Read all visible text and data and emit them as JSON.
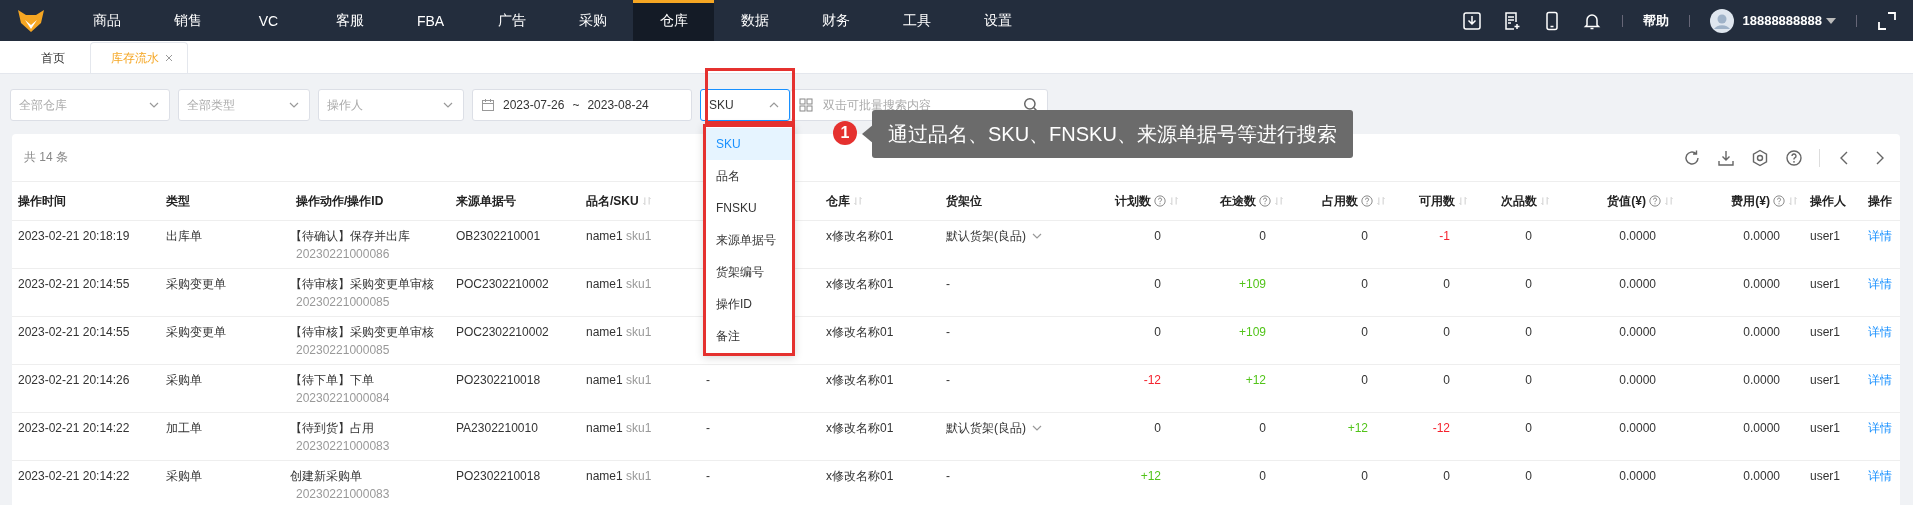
{
  "nav": {
    "items": [
      {
        "label": "商品",
        "selected": false
      },
      {
        "label": "销售",
        "selected": false
      },
      {
        "label": "VC",
        "selected": false
      },
      {
        "label": "客服",
        "selected": false
      },
      {
        "label": "FBA",
        "selected": false
      },
      {
        "label": "广告",
        "selected": false
      },
      {
        "label": "采购",
        "selected": false
      },
      {
        "label": "仓库",
        "selected": true
      },
      {
        "label": "数据",
        "selected": false
      },
      {
        "label": "财务",
        "selected": false
      },
      {
        "label": "工具",
        "selected": false
      },
      {
        "label": "设置",
        "selected": false
      }
    ],
    "help": "帮助",
    "user": "18888888888"
  },
  "tabs": [
    {
      "label": "首页",
      "selected": false,
      "closable": false
    },
    {
      "label": "库存流水",
      "selected": true,
      "closable": true
    }
  ],
  "filters": {
    "warehouse": "全部仓库",
    "type": "全部类型",
    "operator": "操作人",
    "date_start": "2023-07-26",
    "date_sep": "~",
    "date_end": "2023-08-24",
    "search_field": "SKU",
    "search_placeholder": "双击可批量搜索内容"
  },
  "search_field_menu": [
    {
      "label": "SKU",
      "selected": true
    },
    {
      "label": "品名",
      "selected": false
    },
    {
      "label": "FNSKU",
      "selected": false
    },
    {
      "label": "来源单据号",
      "selected": false
    },
    {
      "label": "货架编号",
      "selected": false
    },
    {
      "label": "操作ID",
      "selected": false
    },
    {
      "label": "备注",
      "selected": false
    }
  ],
  "callout": {
    "number": "1",
    "text": "通过品名、SKU、FNSKU、来源单据号等进行搜索"
  },
  "table": {
    "total": "共 14 条",
    "columns": [
      {
        "label": "操作时间",
        "help": false,
        "sortable": false
      },
      {
        "label": "类型",
        "help": false,
        "sortable": false
      },
      {
        "label": "操作动作/操作ID",
        "help": false,
        "sortable": false
      },
      {
        "label": "来源单据号",
        "help": false,
        "sortable": false
      },
      {
        "label": "品名/SKU",
        "help": false,
        "sortable": true
      },
      {
        "label": "仓库",
        "help": false,
        "sortable": true
      },
      {
        "label": "货架位",
        "help": false,
        "sortable": false
      },
      {
        "label": "计划数",
        "help": true,
        "sortable": true
      },
      {
        "label": "在途数",
        "help": true,
        "sortable": true
      },
      {
        "label": "占用数",
        "help": true,
        "sortable": true
      },
      {
        "label": "可用数",
        "help": false,
        "sortable": true
      },
      {
        "label": "次品数",
        "help": false,
        "sortable": true
      },
      {
        "label": "货值(¥)",
        "help": true,
        "sortable": true
      },
      {
        "label": "费用(¥)",
        "help": true,
        "sortable": true
      },
      {
        "label": "操作人",
        "help": false,
        "sortable": false
      },
      {
        "label": "操作",
        "help": false,
        "sortable": false
      }
    ],
    "rows": [
      {
        "time": "2023-02-21 20:18:19",
        "type": "出库单",
        "action": "【待确认】保存并出库",
        "action_id": "20230221000086",
        "source_no": "OB2302210001",
        "name": "name1",
        "sku": "sku1",
        "warehouse": "x修改名称01",
        "shelf": "默认货架(良品)",
        "shelf_dropdown": true,
        "nums": [
          {
            "text": "0"
          },
          {
            "text": "0"
          },
          {
            "text": "0"
          },
          {
            "text": "-1",
            "color": "#f5222d"
          },
          {
            "text": "0"
          }
        ],
        "value": "0.0000",
        "cost": "0.0000",
        "operator": "user1",
        "link": "详情"
      },
      {
        "time": "2023-02-21 20:14:55",
        "type": "采购变更单",
        "action": "【待审核】采购变更单审核",
        "action_id": "20230221000085",
        "source_no": "POC2302210002",
        "name": "name1",
        "sku": "sku1",
        "warehouse": "x修改名称01",
        "shelf": "-",
        "shelf_dropdown": false,
        "nums": [
          {
            "text": "0"
          },
          {
            "text": "+109",
            "color": "#52c41a"
          },
          {
            "text": "0"
          },
          {
            "text": "0"
          },
          {
            "text": "0"
          }
        ],
        "value": "0.0000",
        "cost": "0.0000",
        "operator": "user1",
        "link": "详情"
      },
      {
        "time": "2023-02-21 20:14:55",
        "type": "采购变更单",
        "action": "【待审核】采购变更单审核",
        "action_id": "20230221000085",
        "source_no": "POC2302210002",
        "name": "name1",
        "sku": "sku1",
        "warehouse": "x修改名称01",
        "shelf": "-",
        "shelf_dropdown": false,
        "nums": [
          {
            "text": "0"
          },
          {
            "text": "+109",
            "color": "#52c41a"
          },
          {
            "text": "0"
          },
          {
            "text": "0"
          },
          {
            "text": "0"
          }
        ],
        "value": "0.0000",
        "cost": "0.0000",
        "operator": "user1",
        "link": "详情"
      },
      {
        "time": "2023-02-21 20:14:26",
        "type": "采购单",
        "action": "【待下单】下单",
        "action_id": "20230221000084",
        "source_no": "PO2302210018",
        "name": "name1",
        "sku": "sku1",
        "column_6": "-",
        "warehouse": "x修改名称01",
        "shelf": "-",
        "shelf_dropdown": false,
        "nums": [
          {
            "text": "-12",
            "color": "#f5222d"
          },
          {
            "text": "+12",
            "color": "#52c41a"
          },
          {
            "text": "0"
          },
          {
            "text": "0"
          },
          {
            "text": "0"
          }
        ],
        "value": "0.0000",
        "cost": "0.0000",
        "operator": "user1",
        "link": "详情"
      },
      {
        "time": "2023-02-21 20:14:22",
        "type": "加工单",
        "action": "【待到货】占用",
        "action_id": "20230221000083",
        "source_no": "PA2302210010",
        "name": "name1",
        "sku": "sku1",
        "column_6": "-",
        "warehouse": "x修改名称01",
        "shelf": "默认货架(良品)",
        "shelf_dropdown": true,
        "nums": [
          {
            "text": "0"
          },
          {
            "text": "0"
          },
          {
            "text": "+12",
            "color": "#52c41a"
          },
          {
            "text": "-12",
            "color": "#f5222d"
          },
          {
            "text": "0"
          }
        ],
        "value": "0.0000",
        "cost": "0.0000",
        "operator": "user1",
        "link": "详情"
      },
      {
        "time": "2023-02-21 20:14:22",
        "type": "采购单",
        "action": "创建新采购单",
        "action_id": "20230221000083",
        "source_no": "PO2302210018",
        "name": "name1",
        "sku": "sku1",
        "column_6": "-",
        "warehouse": "x修改名称01",
        "shelf": "-",
        "shelf_dropdown": false,
        "nums": [
          {
            "text": "+12",
            "color": "#52c41a"
          },
          {
            "text": "0"
          },
          {
            "text": "0"
          },
          {
            "text": "0"
          },
          {
            "text": "0"
          }
        ],
        "value": "0.0000",
        "cost": "0.0000",
        "operator": "user1",
        "link": "详情"
      }
    ]
  }
}
